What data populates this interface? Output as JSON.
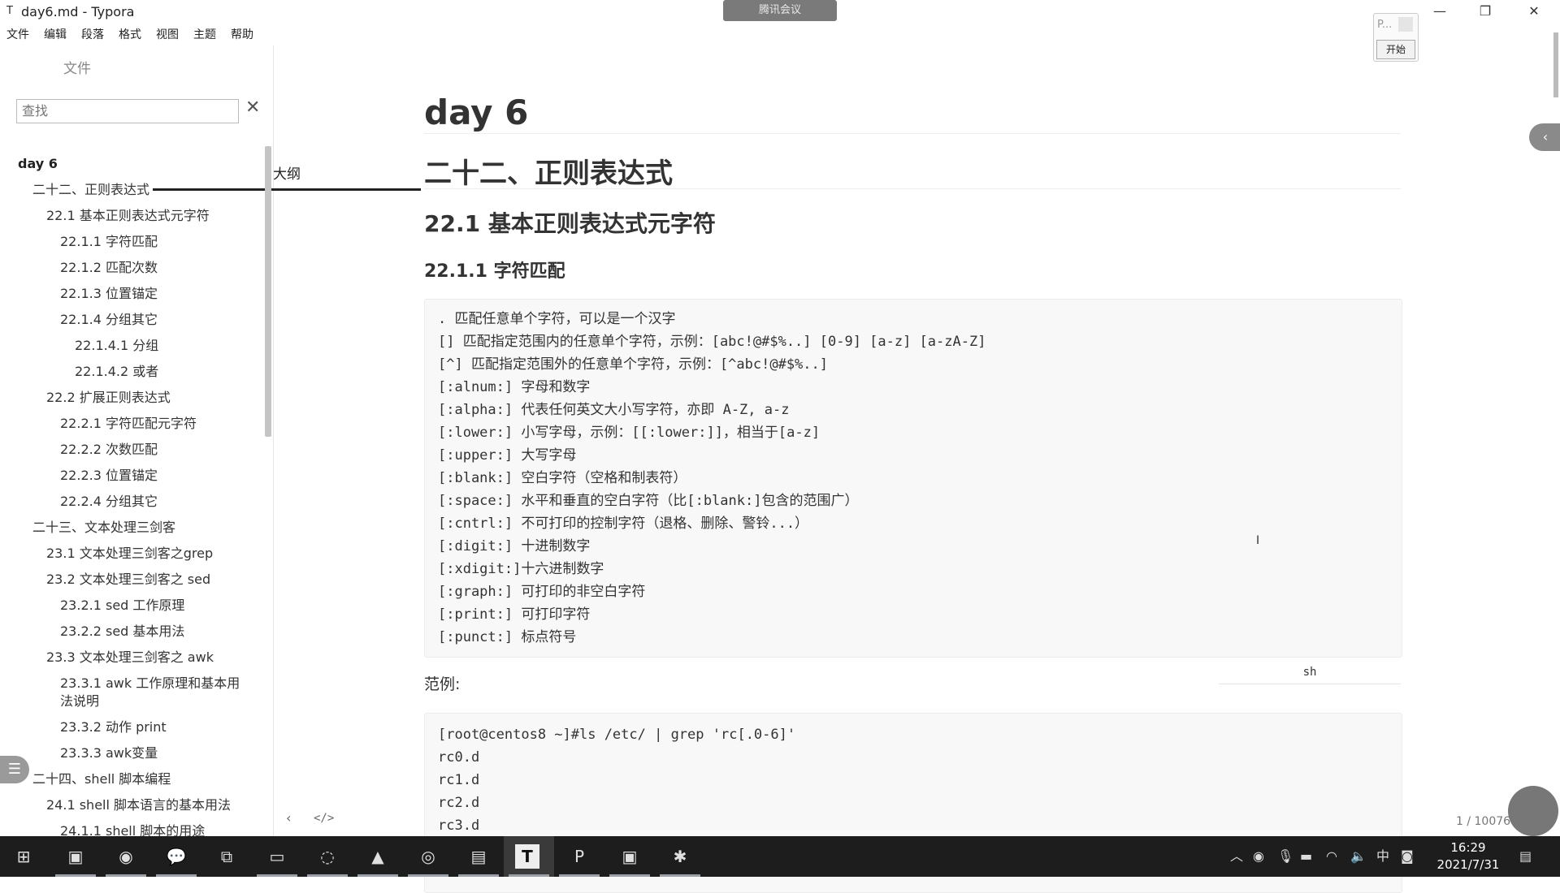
{
  "window": {
    "title": "day6.md - Typora",
    "app_icon": "T",
    "meeting_label": "腾讯会议",
    "minimize": "—",
    "maximize": "❐",
    "close": "✕"
  },
  "menu": [
    "文件",
    "编辑",
    "段落",
    "格式",
    "视图",
    "主题",
    "帮助"
  ],
  "sidebar": {
    "tab_files": "文件",
    "tab_outline": "大纲",
    "search_placeholder": "查找",
    "outline": [
      {
        "label": "day 6",
        "level": 1
      },
      {
        "label": "二十二、正则表达式",
        "level": 2
      },
      {
        "label": "22.1 基本正则表达式元字符",
        "level": 3
      },
      {
        "label": "22.1.1 字符匹配",
        "level": 4
      },
      {
        "label": "22.1.2 匹配次数",
        "level": 4
      },
      {
        "label": "22.1.3 位置锚定",
        "level": 4
      },
      {
        "label": "22.1.4 分组其它",
        "level": 4
      },
      {
        "label": "22.1.4.1 分组",
        "level": 5
      },
      {
        "label": "22.1.4.2 或者",
        "level": 5
      },
      {
        "label": "22.2 扩展正则表达式",
        "level": 3
      },
      {
        "label": "22.2.1 字符匹配元字符",
        "level": 4
      },
      {
        "label": "22.2.2 次数匹配",
        "level": 4
      },
      {
        "label": "22.2.3 位置锚定",
        "level": 4
      },
      {
        "label": "22.2.4 分组其它",
        "level": 4
      },
      {
        "label": "二十三、文本处理三剑客",
        "level": 2
      },
      {
        "label": "23.1 文本处理三剑客之grep",
        "level": 3
      },
      {
        "label": "23.2 文本处理三剑客之 sed",
        "level": 3
      },
      {
        "label": "23.2.1 sed 工作原理",
        "level": 4
      },
      {
        "label": "23.2.2 sed 基本用法",
        "level": 4
      },
      {
        "label": "23.3 文本处理三剑客之 awk",
        "level": 3
      },
      {
        "label": "23.3.1 awk 工作原理和基本用法说明",
        "level": 4
      },
      {
        "label": "23.3.2 动作 print",
        "level": 4
      },
      {
        "label": "23.3.3 awk变量",
        "level": 4
      },
      {
        "label": "二十四、shell 脚本编程",
        "level": 2
      },
      {
        "label": "24.1 shell 脚本语言的基本用法",
        "level": 3
      },
      {
        "label": "24.1.1 shell 脚本的用途",
        "level": 4
      }
    ],
    "bottom_prev": "‹",
    "bottom_source": "</>"
  },
  "document": {
    "h1": "day 6",
    "h1b": "二十二、正则表达式",
    "h2": "22.1 基本正则表达式元字符",
    "h3": "22.1.1 字符匹配",
    "code_block_1": [
      ". 匹配任意单个字符，可以是一个汉字",
      "[] 匹配指定范围内的任意单个字符，示例：[abc!@#$%..] [0-9] [a-z] [a-zA-Z]",
      "[^] 匹配指定范围外的任意单个字符，示例：[^abc!@#$%..]",
      "[:alnum:] 字母和数字",
      "[:alpha:] 代表任何英文大小写字符，亦即 A-Z, a-z",
      "[:lower:] 小写字母，示例：[[:lower:]]，相当于[a-z]",
      "[:upper:] 大写字母",
      "[:blank:] 空白字符（空格和制表符）",
      "[:space:] 水平和垂直的空白字符（比[:blank:]包含的范围广）",
      "[:cntrl:] 不可打印的控制字符（退格、删除、警铃...）",
      "[:digit:] 十进制数字",
      "[:xdigit:]十六进制数字",
      "[:graph:] 可打印的非空白字符",
      "[:print:] 可打印字符",
      "[:punct:] 标点符号"
    ],
    "code_lang": "sh",
    "paragraph": "范例:",
    "code_block_2": [
      "[root@centos8 ~]#ls /etc/ | grep 'rc[.0-6]'",
      "rc0.d",
      "rc1.d",
      "rc2.d",
      "rc3.d"
    ]
  },
  "right_panel": {
    "mini_label": "P...",
    "start_button": "开始",
    "word_count": "1 / 10076"
  },
  "taskbar": {
    "time": "16:29",
    "date": "2021/7/31",
    "ime": "中"
  }
}
